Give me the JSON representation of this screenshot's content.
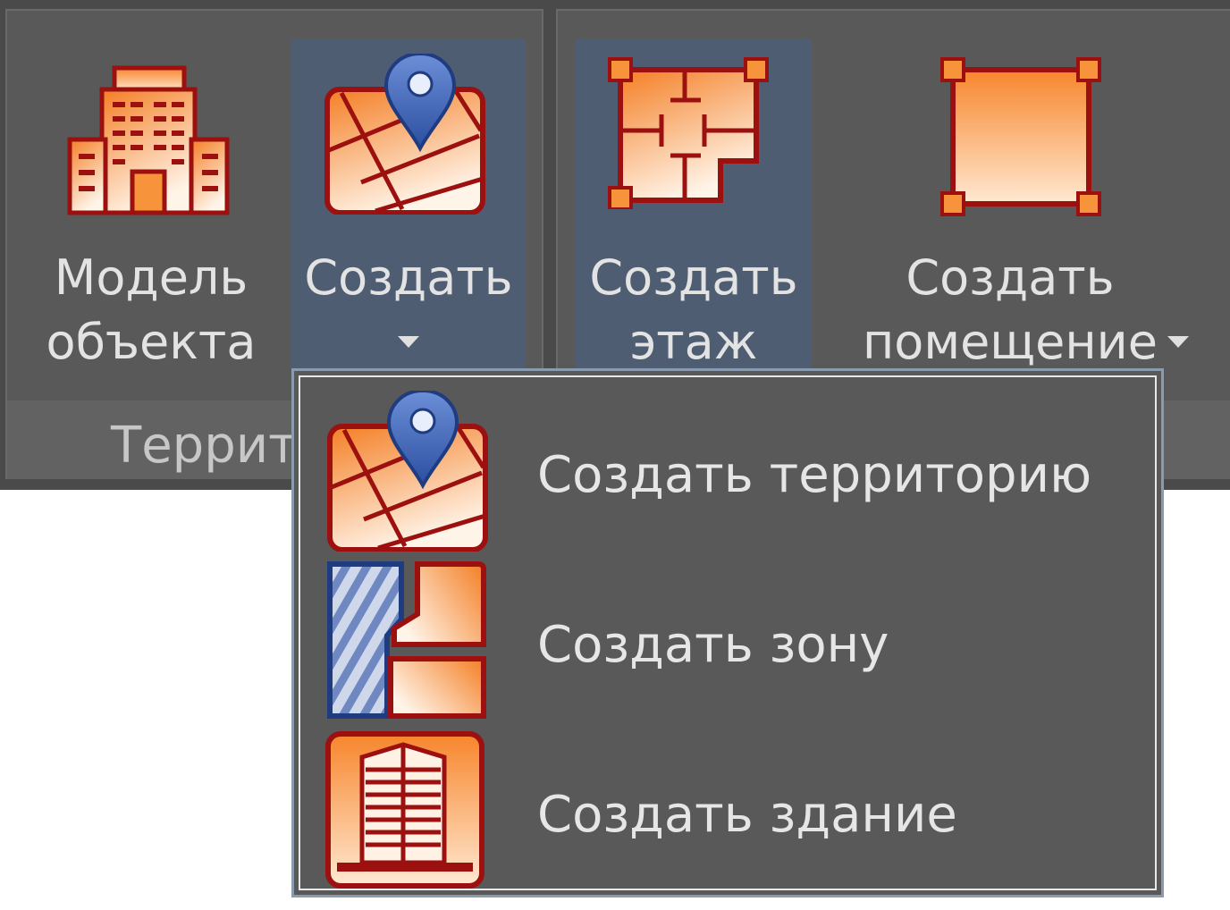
{
  "panels": {
    "territory": {
      "footer_label": "Террит",
      "model_button": {
        "line1": "Модель",
        "line2": "объекта",
        "icon": "buildings-icon"
      },
      "create_button": {
        "label": "Создать",
        "icon": "map-pin-icon"
      }
    },
    "floors": {
      "create_floor_button": {
        "line1": "Создать",
        "line2": "этаж",
        "icon": "floor-plan-icon"
      },
      "create_room_button": {
        "line1": "Создать",
        "line2": "помещение",
        "icon": "room-icon"
      }
    }
  },
  "dropdown": {
    "items": [
      {
        "label": "Создать территорию",
        "icon": "map-pin-icon"
      },
      {
        "label": "Создать зону",
        "icon": "zone-icon"
      },
      {
        "label": "Создать здание",
        "icon": "building-icon"
      }
    ]
  },
  "colors": {
    "ribbon_bg": "#4a4a4a",
    "panel_bg": "#595959",
    "highlight": "#4e5d71",
    "icon_orange": "#f7933a",
    "icon_outline": "#9c1010",
    "pin_blue": "#4a6fc0"
  }
}
